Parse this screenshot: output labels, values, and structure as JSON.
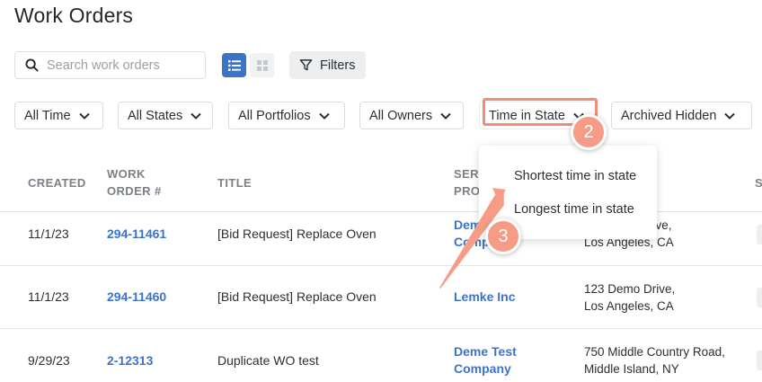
{
  "page": {
    "title": "Work Orders"
  },
  "toolbar": {
    "search_placeholder": "Search work orders",
    "filters_label": "Filters"
  },
  "filter_chips": {
    "time": "All Time",
    "states": "All States",
    "portfolios": "All Portfolios",
    "owners": "All Owners",
    "time_in_state": "Time in State",
    "archived": "Archived Hidden"
  },
  "table": {
    "headers": {
      "created": "CREATED",
      "wo_line1": "WORK",
      "wo_line2": "ORDER #",
      "title": "TITLE",
      "sp_line1": "SERV",
      "sp_line2": "PRO",
      "status": "S"
    },
    "rows": [
      {
        "created": "11/1/23",
        "wo": "294-11461",
        "title": "[Bid Request] Replace Oven",
        "provider_line1": "Deme",
        "provider_line2": "Comp",
        "addr_line1": "rive,",
        "addr_line2": "Los Angeles, CA"
      },
      {
        "created": "11/1/23",
        "wo": "294-11460",
        "title": "[Bid Request] Replace Oven",
        "provider_line1": "Lemke Inc",
        "provider_line2": "",
        "addr_line1": "123 Demo Drive,",
        "addr_line2": "Los Angeles, CA"
      },
      {
        "created": "9/29/23",
        "wo": "2-12313",
        "title": "Duplicate WO test",
        "provider_line1": "Deme Test",
        "provider_line2": "Company",
        "addr_line1": "750 Middle Country Road,",
        "addr_line2": "Middle Island, NY"
      }
    ]
  },
  "dropdown": {
    "options": [
      "Shortest time in state",
      "Longest time in state"
    ]
  },
  "annotations": {
    "step2": "2",
    "step3": "3",
    "accent_color": "#f08c7a"
  },
  "colors": {
    "link": "#3b73c9",
    "primary": "#3b73c9"
  }
}
